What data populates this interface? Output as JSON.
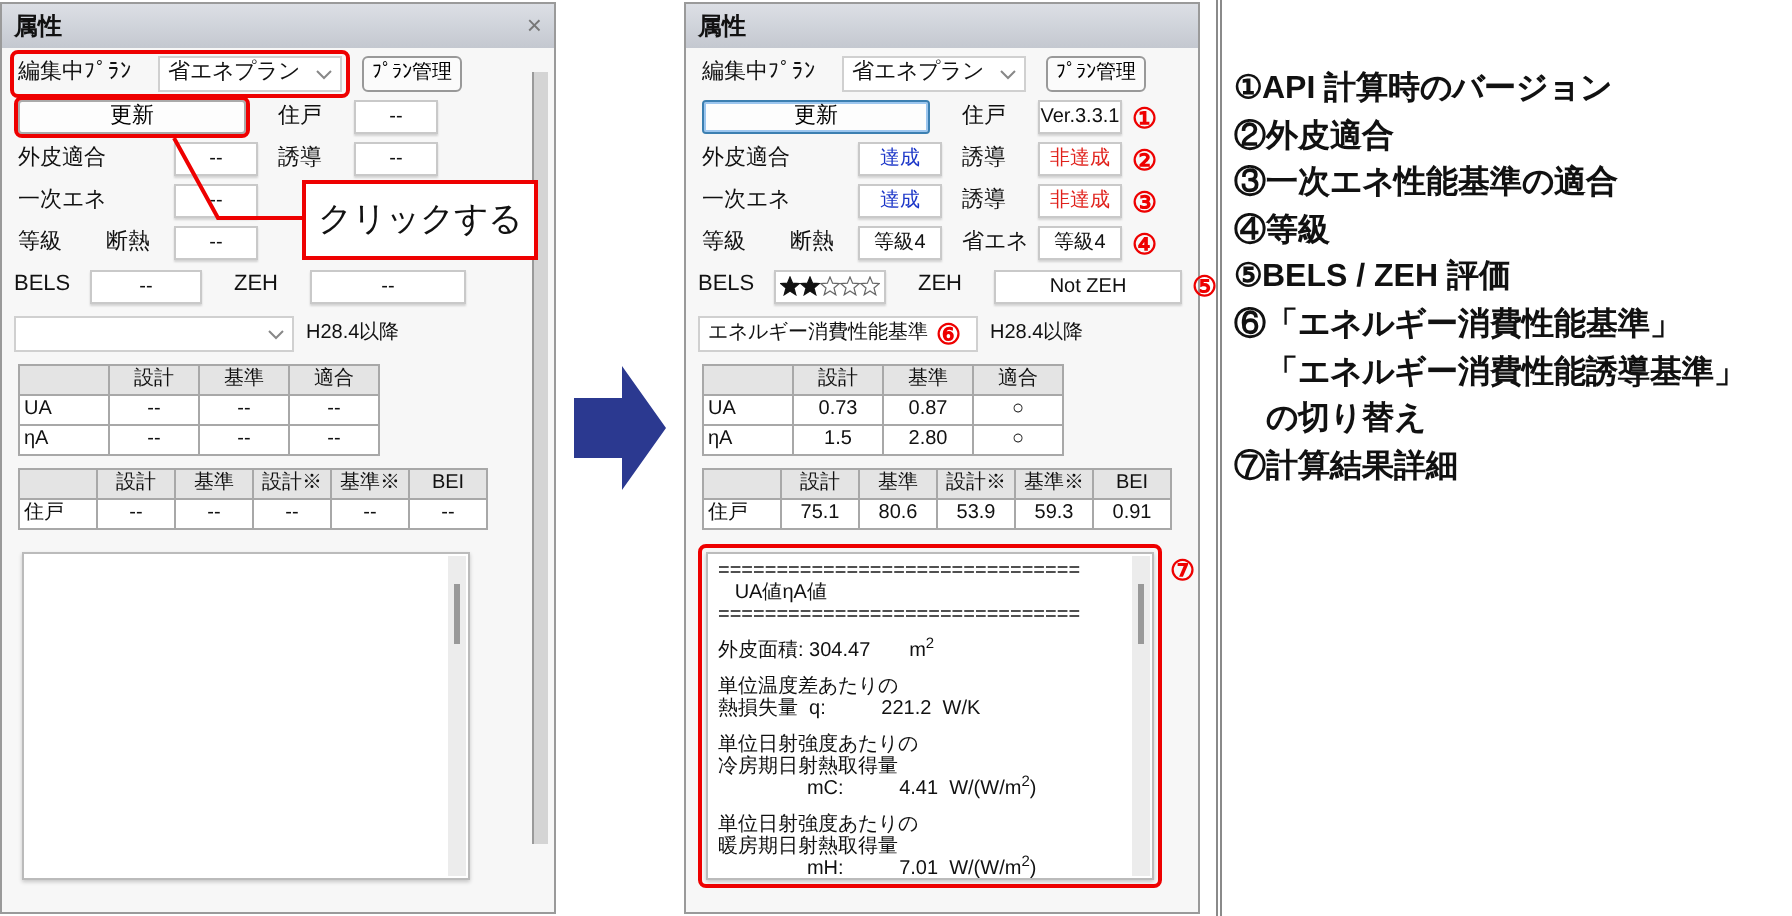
{
  "panels": [
    {
      "title": "属性",
      "close": "×",
      "scrollbar": true,
      "plan": {
        "label": "編集中ﾌﾟﾗﾝ",
        "value": "省エネプラン",
        "button": "ﾌﾟﾗﾝ管理",
        "highlighted": true
      },
      "update": {
        "label": "更新",
        "focused": false,
        "highlighted": true,
        "unit_label": "住戸",
        "unit_value": {
          "text": "--"
        }
      },
      "rows": [
        {
          "label": "外皮適合",
          "value": {
            "text": "--"
          },
          "label2": "誘導",
          "value2": {
            "text": "--"
          }
        },
        {
          "label": "一次エネ",
          "value": {
            "text": "--"
          }
        },
        {
          "label": "等級",
          "sublabel": "断熱",
          "value": {
            "text": "--"
          }
        }
      ],
      "bels": {
        "label": "BELS",
        "value": "--",
        "label2": "ZEH",
        "value2": "--"
      },
      "standard": {
        "note": "H28.4以降"
      },
      "table1": {
        "columns": [
          "設計",
          "基準",
          "適合"
        ],
        "rows": [
          {
            "head": "UA",
            "cells": [
              "--",
              "--",
              "--"
            ]
          },
          {
            "head": "ηA",
            "cells": [
              "--",
              "--",
              "--"
            ]
          }
        ]
      },
      "table2": {
        "columns": [
          "設計",
          "基準",
          "設計※",
          "基準※",
          "BEI"
        ],
        "rows": [
          {
            "head": "住戸",
            "cells": [
              "--",
              "--",
              "--",
              "--",
              "--"
            ]
          }
        ]
      },
      "detail": {
        "highlighted": false
      },
      "callout": {
        "text": "クリックする"
      }
    },
    {
      "title": "属性",
      "plan": {
        "label": "編集中ﾌﾟﾗﾝ",
        "value": "省エネプラン",
        "button": "ﾌﾟﾗﾝ管理",
        "highlighted": false
      },
      "update": {
        "label": "更新",
        "focused": true,
        "highlighted": false,
        "unit_label": "住戸",
        "unit_value": {
          "text": "Ver.3.3.1"
        },
        "marker": "①"
      },
      "rows": [
        {
          "label": "外皮適合",
          "value": {
            "text": "達成",
            "color": "#1a35c8"
          },
          "label2": "誘導",
          "value2": {
            "text": "非達成",
            "color": "#e0201a"
          },
          "marker": "②"
        },
        {
          "label": "一次エネ",
          "value": {
            "text": "達成",
            "color": "#1a35c8"
          },
          "label2": "誘導",
          "value2": {
            "text": "非達成",
            "color": "#e0201a"
          },
          "marker": "③"
        },
        {
          "label": "等級",
          "sublabel": "断熱",
          "value": {
            "text": "等級4"
          },
          "label2": "省エネ",
          "value2": {
            "text": "等級4"
          },
          "marker": "④"
        }
      ],
      "bels": {
        "label": "BELS",
        "stars": 2,
        "label2": "ZEH",
        "value2": "Not ZEH",
        "marker": "⑤"
      },
      "standard": {
        "value": "エネルギー消費性能基準",
        "marker": "⑥",
        "note": "H28.4以降"
      },
      "table1": {
        "columns": [
          "設計",
          "基準",
          "適合"
        ],
        "rows": [
          {
            "head": "UA",
            "cells": [
              "0.73",
              "0.87",
              "○"
            ]
          },
          {
            "head": "ηA",
            "cells": [
              "1.5",
              "2.80",
              "○"
            ]
          }
        ]
      },
      "table2": {
        "columns": [
          "設計",
          "基準",
          "設計※",
          "基準※",
          "BEI"
        ],
        "rows": [
          {
            "head": "住戸",
            "cells": [
              "75.1",
              "80.6",
              "53.9",
              "59.3",
              "0.91"
            ]
          }
        ]
      },
      "detail": {
        "highlighted": true,
        "marker": "⑦",
        "blocks": [
          [
            "===============================",
            "   UA値ηA値",
            "==============================="
          ],
          [
            "外皮面積: 304.47       m$^{2}$"
          ],
          [
            "単位温度差あたりの",
            "熱損失量  q:          221.2  W/K"
          ],
          [
            "単位日射強度あたりの",
            "冷房期日射熱取得量",
            "                mC:          4.41  W/(W/m$^{2}$)"
          ],
          [
            "単位日射強度あたりの",
            "暖房期日射熱取得量",
            "                mH:          7.01  W/(W/m$^{2}$)"
          ]
        ]
      }
    }
  ],
  "notes": [
    {
      "text": "①API 計算時のバージョン",
      "kind": "item"
    },
    {
      "text": "②外皮適合",
      "kind": "item"
    },
    {
      "text": "③一次エネ性能基準の適合",
      "kind": "item"
    },
    {
      "text": "④等級",
      "kind": "item"
    },
    {
      "text": "⑤BELS / ZEH 評価",
      "kind": "item"
    },
    {
      "text": "⑥「エネルギー消費性能基準」",
      "kind": "item"
    },
    {
      "text": "「エネルギー消費性能誘導基準」",
      "kind": "continuation"
    },
    {
      "text": "の切り替え",
      "kind": "continuation"
    },
    {
      "text": "⑦計算結果詳細",
      "kind": "item"
    }
  ]
}
